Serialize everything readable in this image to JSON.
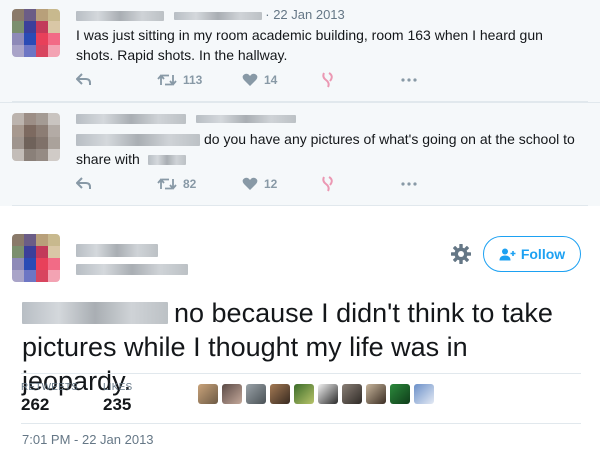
{
  "tweet1": {
    "date": "· 22 Jan 2013",
    "text": "I was just sitting in my room academic building, room 163 when I heard gun shots. Rapid shots. In the hallway.",
    "retweet_count": "113",
    "like_count": "14",
    "reply_icon": "reply-icon",
    "retweet_icon": "retweet-icon",
    "like_icon": "heart-icon",
    "more_icon": "more-icon"
  },
  "tweet2": {
    "text_line1": "do you have any pictures of what's going on at the school to",
    "text_line2_prefix": "share with",
    "retweet_count": "82",
    "like_count": "12"
  },
  "main_tweet": {
    "follow_label": "Follow",
    "text_line1": "no because I didn't think to take",
    "text_line2": "pictures while I thought my life was in jeopardy.",
    "retweets_label": "RETWEETS",
    "retweets_value": "262",
    "likes_label": "LIKES",
    "likes_value": "235",
    "timestamp": "7:01 PM - 22 Jan 2013",
    "liker_count": 10
  },
  "colors": {
    "accent": "#1da1f2",
    "muted": "#8899a6",
    "context_bg": "#f5f8fa"
  }
}
